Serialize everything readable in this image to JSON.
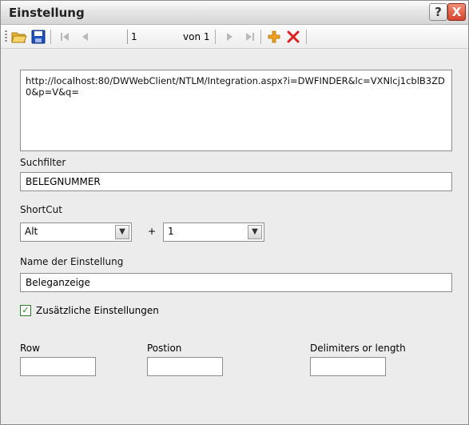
{
  "window": {
    "title": "Einstellung",
    "help_label": "?",
    "close_label": "X"
  },
  "toolbar": {
    "record_value": "1",
    "record_of": "von 1",
    "icons": [
      "open-folder-icon",
      "save-icon",
      "first-record-icon",
      "previous-record-icon",
      "next-record-icon",
      "last-record-icon",
      "add-icon",
      "delete-icon"
    ]
  },
  "url_text": "http://localhost:80/DWWebClient/NTLM/Integration.aspx?i=DWFINDER&lc=VXNlcj1cblB3ZD0&p=V&q=",
  "suchfilter": {
    "label": "Suchfilter",
    "value": "BELEGNUMMER"
  },
  "shortcut": {
    "label": "ShortCut",
    "modifier": "Alt",
    "plus": "+",
    "key": "1"
  },
  "name": {
    "label": "Name der Einstellung",
    "value": "Beleganzeige"
  },
  "extra": {
    "checked": true,
    "label": "Zusätzliche Einstellungen"
  },
  "extra_fields": {
    "row_label": "Row",
    "position_label": "Postion",
    "delimiters_label": "Delimiters or length",
    "row_value": "",
    "position_value": "",
    "delimiters_value": ""
  },
  "colors": {
    "close_red": "#d6432a",
    "save_blue": "#1f4fbf",
    "add_orange": "#f0a020",
    "delete_red": "#e02020"
  }
}
